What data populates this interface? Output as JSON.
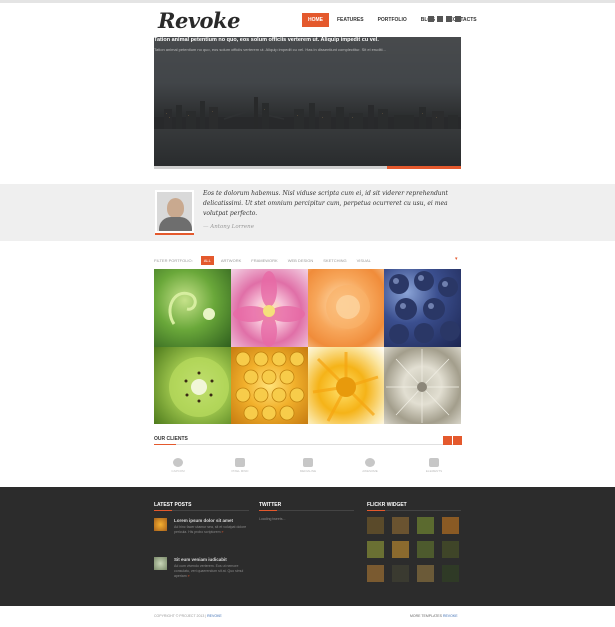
{
  "brand": {
    "logo": "Revoke"
  },
  "nav": {
    "items": [
      {
        "label": "HOME",
        "active": true
      },
      {
        "label": "FEATURES",
        "active": false
      },
      {
        "label": "PORTFOLIO",
        "active": false
      },
      {
        "label": "BLOG",
        "active": false
      },
      {
        "label": "CONTACTS",
        "active": false
      }
    ],
    "social_icons": [
      "facebook-icon",
      "twitter-icon",
      "linkedin-icon",
      "rss-icon"
    ]
  },
  "hero": {
    "caption_title": "Tation animal petentium no quo, eos solum officiis verterem ut. Aliquip impedit cu vel.",
    "caption_text": "Tation animal petentium no quo, eos solum officiis verterem ut. Aliquip impedit cu vel. Has in dissentiunt complectitur. Sit ei eruditi...",
    "slide_progress": 0.76
  },
  "testimonial": {
    "quote": "Eos te dolorum habemus. Nisl viduse scripta cum ei, id sit viderer reprehendunt delicatissimi. Ut stet omnium percipitur cum, perpetua ocurreret cu usu, ei mea volutpat perfecto.",
    "author": "— Antony Lorrene"
  },
  "portfolio": {
    "filter_label": "Filter portfolio:",
    "filters": [
      {
        "label": "ALL",
        "active": true
      },
      {
        "label": "ARTWORK",
        "active": false
      },
      {
        "label": "FRAMEWORK",
        "active": false
      },
      {
        "label": "WEB DESIGN",
        "active": false
      },
      {
        "label": "SKETCHING",
        "active": false
      },
      {
        "label": "VISUAL",
        "active": false
      }
    ]
  },
  "clients": {
    "title": "OUR CLIENTS",
    "logos": [
      "CAPCOM",
      "PIXEL MIND",
      "MEDIALINE",
      "AWESOME",
      "ELEMENTS"
    ]
  },
  "footer": {
    "latest_posts_title": "LATEST POSTS",
    "twitter_title": "TWITTER",
    "flickr_title": "FLICKR WIDGET",
    "posts": [
      {
        "title": "Lorem ipsum dolor sit amet",
        "text": "Ad hinc facer utamur sea, sit et volutpat dolore pericula. His probo scriptorem",
        "more": "»"
      },
      {
        "title": "Sit eum veniam iudicabit",
        "text": "Ad cum vivendo verterem. Eos ut nemore consulatu, veri quaerendum sit at. Quo simul aperiam",
        "more": "»"
      }
    ],
    "tweet": "Loading tweets...",
    "copyright_text": "COPYRIGHT © PROJECT 2013 | ",
    "copyright_link": "REVOKE",
    "more_templates_text": "MORE TEMPLATES ",
    "more_templates_link": "REVOKE"
  },
  "colors": {
    "accent": "#e4592d",
    "footer_bg": "#2c2c2c",
    "band_bg": "#efefef"
  }
}
